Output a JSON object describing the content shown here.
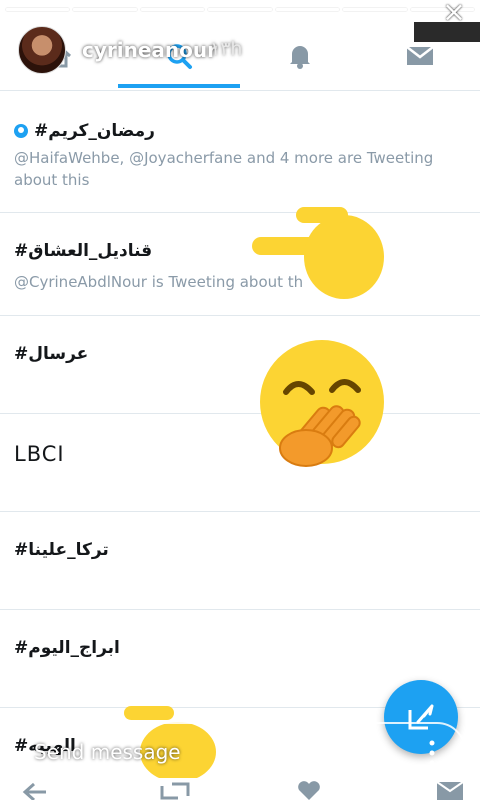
{
  "story": {
    "user": "cyrineanour",
    "time": "١٣h",
    "send_placeholder": "Send message",
    "segments": 7
  },
  "topbar": {
    "tabs": [
      "home",
      "search",
      "notifications",
      "messages"
    ],
    "active_tab": "search",
    "accent": "#1da1f2"
  },
  "trends": [
    {
      "name": "#رمضان_كريم",
      "promoted": true,
      "subtitle": "@HaifaWehbe, @Joyacherfane and 4 more are Tweeting about this"
    },
    {
      "name": "#قناديل_العشاق",
      "promoted": false,
      "subtitle": "@CyrineAbdlNour is Tweeting about th"
    },
    {
      "name": "#عرسال",
      "promoted": false,
      "subtitle": ""
    },
    {
      "name": "LBCI",
      "promoted": false,
      "subtitle": ""
    },
    {
      "name": "#تركا_علينا",
      "promoted": false,
      "subtitle": ""
    },
    {
      "name": "#ابراج_اليوم",
      "promoted": false,
      "subtitle": ""
    },
    {
      "name": "#الهيبه",
      "promoted": false,
      "subtitle": ""
    }
  ],
  "colors": {
    "sticker_yellow": "#fcd433",
    "hand_orange": "#f39a2b",
    "subtitle_grey": "#8a9aa8"
  },
  "icons": [
    "close-icon",
    "search-icon",
    "bell-icon",
    "mail-icon",
    "compose-icon",
    "add-person-icon",
    "more-icon",
    "reply-icon",
    "retweet-icon",
    "like-icon"
  ]
}
